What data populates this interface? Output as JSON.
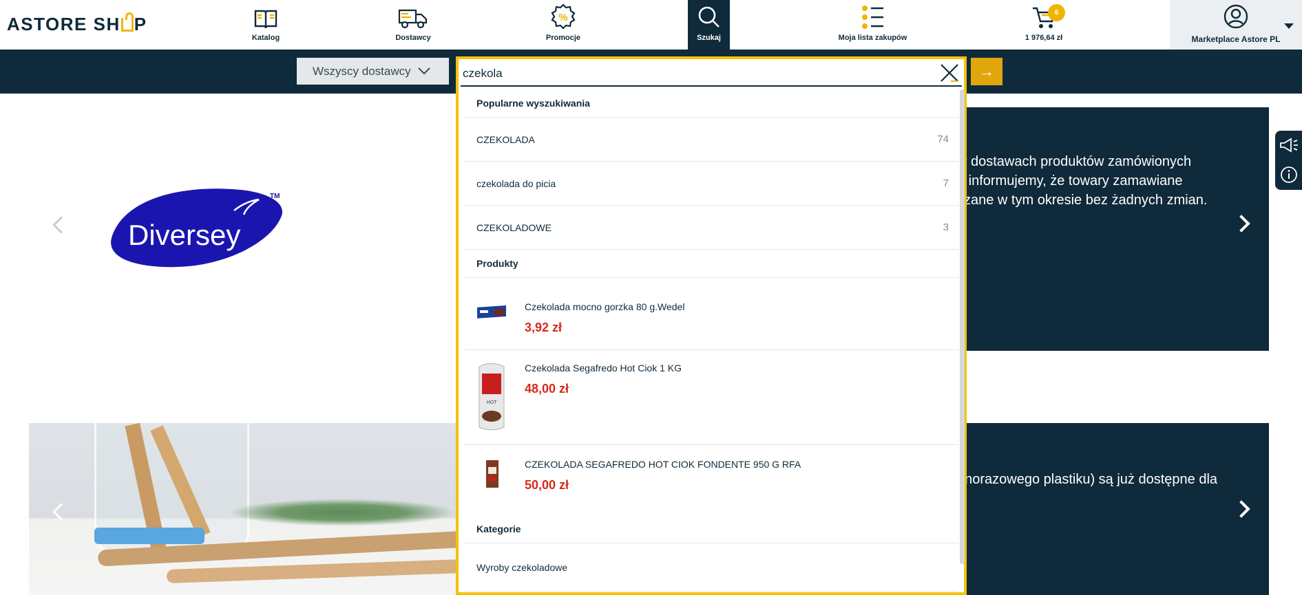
{
  "header": {
    "logo": "ASTORE SHOP",
    "nav": [
      {
        "label": "Katalog",
        "icon": "book-icon"
      },
      {
        "label": "Dostawcy",
        "icon": "truck-icon"
      },
      {
        "label": "Promocje",
        "icon": "percent-badge-icon"
      },
      {
        "label": "Szukaj",
        "icon": "search-icon"
      },
      {
        "label": "Moja lista zakupów",
        "icon": "list-icon"
      },
      {
        "label": "1 976,64 zł",
        "icon": "cart-icon"
      }
    ],
    "cart_count": "6",
    "account_label": "Marketplace Astore PL"
  },
  "search": {
    "supplier_filter": "Wszyscy dostawcy",
    "query": "czekola",
    "go_symbol": "→"
  },
  "dropdown": {
    "popular_heading": "Popularne wyszukiwania",
    "popular": [
      {
        "term": "CZEKOLADA",
        "count": "74"
      },
      {
        "term": "czekolada do picia",
        "count": "7"
      },
      {
        "term": "CZEKOLADOWE",
        "count": "3"
      }
    ],
    "products_heading": "Produkty",
    "products": [
      {
        "name": "Czekolada mocno gorzka 80 g.Wedel",
        "price": "3,92 zł"
      },
      {
        "name": "Czekolada Segafredo Hot Ciok 1 KG",
        "price": "48,00 zł"
      },
      {
        "name": "CZEKOLADA SEGAFREDO HOT CIOK FONDENTE 950 G RFA",
        "price": "50,00 zł"
      }
    ],
    "categories_heading": "Kategorie",
    "categories": [
      "Wyroby czekoladowe"
    ]
  },
  "banners": {
    "top_text_lines": [
      "w dostawach produktów zamówionych",
      "e informujemy, że towary zamawiane",
      "czane w tym okresie bez żadnych zmian."
    ],
    "bottom_text": "dnorazowego plastiku) są już dostępne dla",
    "brand_logo_text": "Diversey"
  },
  "colors": {
    "navy": "#0f2a3a",
    "accent_yellow": "#f5c20a",
    "price_red": "#d6291c"
  }
}
